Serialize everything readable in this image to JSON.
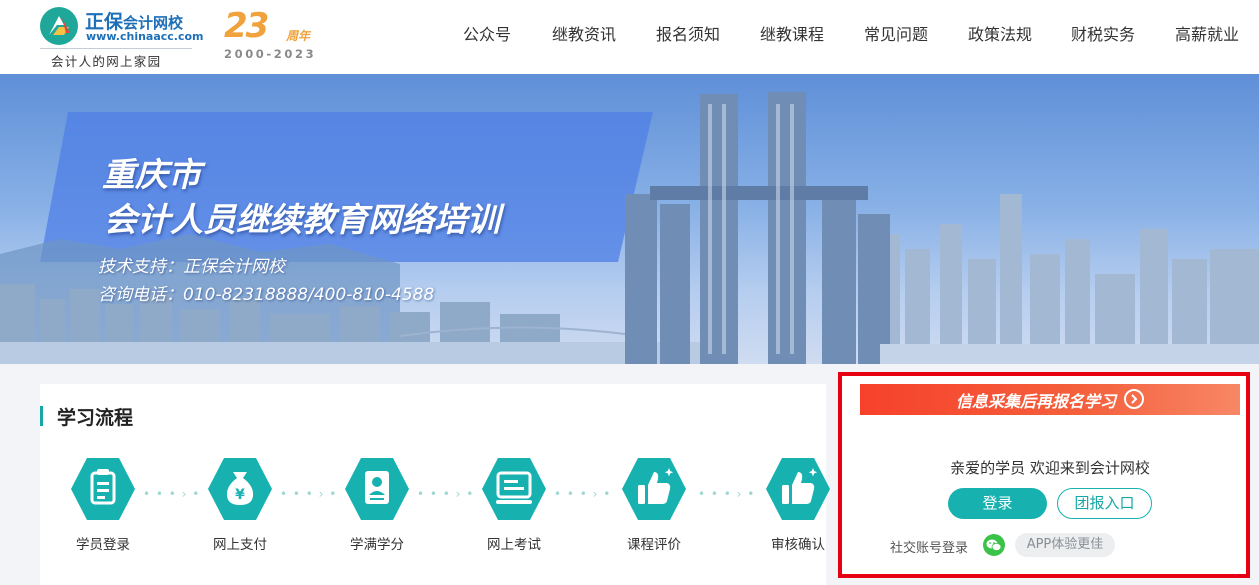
{
  "header": {
    "logo_brand": "正保",
    "logo_school": "会计网校",
    "logo_url": "www.chinaacc.com",
    "logo_slogan": "会计人的网上家园",
    "anniversary_number": "23",
    "anniversary_suffix": "周年",
    "anniversary_years": "2000-2023"
  },
  "nav": {
    "items": [
      "公众号",
      "继教资讯",
      "报名须知",
      "继教课程",
      "常见问题",
      "政策法规",
      "财税实务",
      "高薪就业"
    ]
  },
  "banner": {
    "title_line1": "重庆市",
    "title_line2": "会计人员继续教育网络培训",
    "support": "技术支持：正保会计网校",
    "hotline": "咨询电话：010-82318888/400-810-4588"
  },
  "process": {
    "title": "学习流程",
    "steps": [
      {
        "label": "学员登录",
        "icon": "clipboard-icon"
      },
      {
        "label": "网上支付",
        "icon": "money-bag-icon"
      },
      {
        "label": "学满学分",
        "icon": "certificate-icon"
      },
      {
        "label": "网上考试",
        "icon": "computer-icon"
      },
      {
        "label": "课程评价",
        "icon": "thumbs-up-icon"
      },
      {
        "label": "审核确认",
        "icon": "thumbs-up-sparkle-icon"
      }
    ],
    "accent_color": "#17b2b0"
  },
  "login": {
    "header_text": "信息采集后再报名学习",
    "welcome": "亲爱的学员 欢迎来到会计网校",
    "login_button": "登录",
    "group_button": "团报入口",
    "social_label": "社交账号登录",
    "app_button": "APP体验更佳",
    "highlight_color": "#e60012"
  }
}
